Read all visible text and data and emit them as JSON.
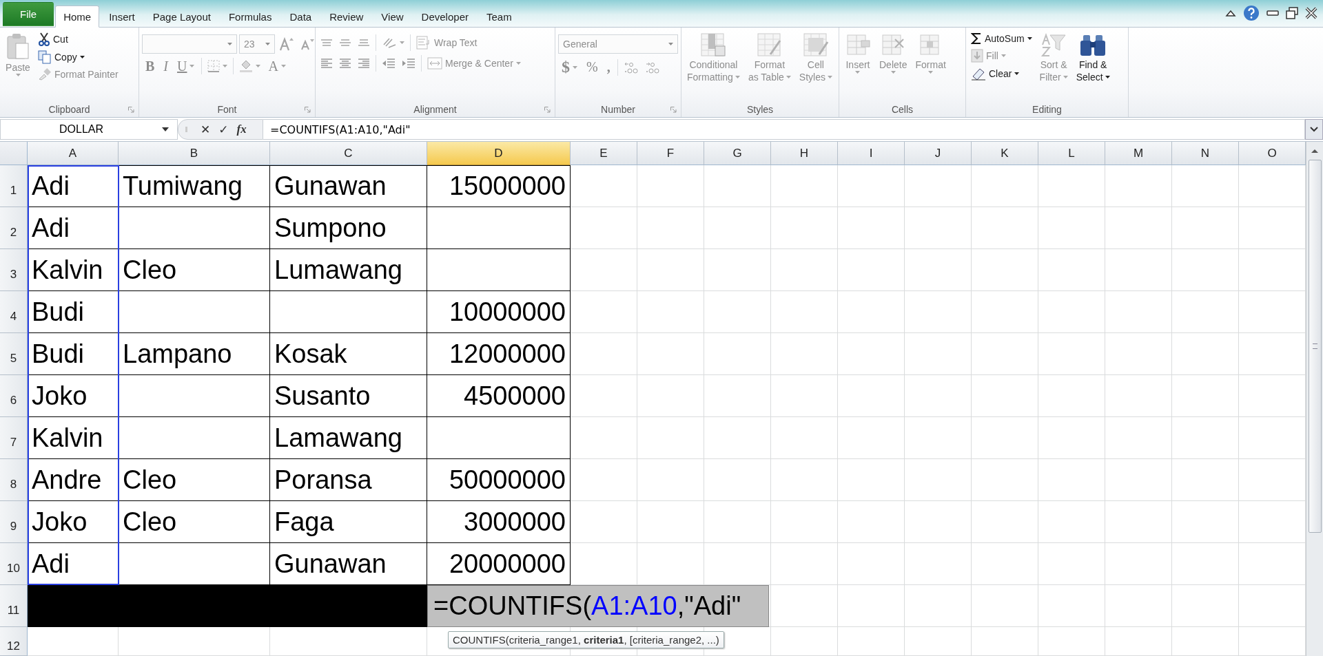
{
  "ribbon_tabs": [
    {
      "label": "File",
      "kind": "file",
      "selected": false
    },
    {
      "label": "Home",
      "kind": "tab",
      "selected": true
    },
    {
      "label": "Insert",
      "kind": "tab",
      "selected": false
    },
    {
      "label": "Page Layout",
      "kind": "tab",
      "selected": false
    },
    {
      "label": "Formulas",
      "kind": "tab",
      "selected": false
    },
    {
      "label": "Data",
      "kind": "tab",
      "selected": false
    },
    {
      "label": "Review",
      "kind": "tab",
      "selected": false
    },
    {
      "label": "View",
      "kind": "tab",
      "selected": false
    },
    {
      "label": "Developer",
      "kind": "tab",
      "selected": false
    },
    {
      "label": "Team",
      "kind": "tab",
      "selected": false
    }
  ],
  "ribbon_groups": [
    {
      "label": "Clipboard",
      "launcher": true,
      "items": [
        {
          "lines": [
            "Paste"
          ],
          "disabled": true,
          "dropdown": true
        },
        {
          "lines": [
            "Cut"
          ],
          "disabled": false,
          "dropdown": false
        },
        {
          "lines": [
            "Copy"
          ],
          "disabled": false,
          "dropdown": true
        },
        {
          "lines": [
            "Format Painter"
          ],
          "disabled": true,
          "dropdown": false
        }
      ]
    },
    {
      "label": "Font",
      "launcher": true,
      "items": [
        {
          "disabled": true,
          "dropdown": true
        },
        {
          "lines": [
            "23"
          ],
          "disabled": true,
          "dropdown": true
        },
        {
          "disabled": true,
          "dropdown": false
        },
        {
          "disabled": true,
          "dropdown": false
        },
        {
          "lines": [
            "B"
          ],
          "disabled": true,
          "dropdown": false
        },
        {
          "lines": [
            "I"
          ],
          "disabled": true,
          "dropdown": false
        },
        {
          "lines": [
            "U"
          ],
          "disabled": true,
          "dropdown": true
        },
        {
          "disabled": true,
          "dropdown": true
        },
        {
          "disabled": true,
          "dropdown": true
        },
        {
          "lines": [
            "A"
          ],
          "disabled": true,
          "dropdown": true
        }
      ]
    },
    {
      "label": "Alignment",
      "launcher": true,
      "items": [
        {
          "disabled": true,
          "dropdown": false
        },
        {
          "disabled": true,
          "dropdown": false
        },
        {
          "disabled": true,
          "dropdown": false
        },
        {
          "disabled": true,
          "dropdown": true
        },
        {
          "lines": [
            "Wrap Text"
          ],
          "disabled": true,
          "dropdown": false
        },
        {
          "disabled": true,
          "dropdown": false
        },
        {
          "disabled": true,
          "dropdown": false
        },
        {
          "disabled": true,
          "dropdown": false
        },
        {
          "disabled": true,
          "dropdown": false
        },
        {
          "disabled": true,
          "dropdown": false
        },
        {
          "lines": [
            "Merge & Center"
          ],
          "disabled": true,
          "dropdown": true
        }
      ]
    },
    {
      "label": "Number",
      "launcher": true,
      "items": [
        {
          "lines": [
            "General"
          ],
          "disabled": true,
          "dropdown": true
        },
        {
          "lines": [
            "$"
          ],
          "disabled": true,
          "dropdown": true
        },
        {
          "lines": [
            "%"
          ],
          "disabled": true,
          "dropdown": false
        },
        {
          "lines": [
            ","
          ],
          "disabled": true,
          "dropdown": false
        },
        {
          "disabled": true,
          "dropdown": false
        },
        {
          "disabled": true,
          "dropdown": false
        }
      ]
    },
    {
      "label": "Styles",
      "launcher": false,
      "items": [
        {
          "lines": [
            "Conditional",
            "Formatting"
          ],
          "disabled": true,
          "dropdown": true
        },
        {
          "lines": [
            "Format",
            "as Table"
          ],
          "disabled": true,
          "dropdown": true
        },
        {
          "lines": [
            "Cell",
            "Styles"
          ],
          "disabled": true,
          "dropdown": true
        }
      ]
    },
    {
      "label": "Cells",
      "launcher": false,
      "items": [
        {
          "lines": [
            "Insert"
          ],
          "disabled": true,
          "dropdown": true
        },
        {
          "lines": [
            "Delete"
          ],
          "disabled": true,
          "dropdown": true
        },
        {
          "lines": [
            "Format"
          ],
          "disabled": true,
          "dropdown": true
        }
      ]
    },
    {
      "label": "Editing",
      "launcher": false,
      "items": [
        {
          "lines": [
            "AutoSum"
          ],
          "disabled": false,
          "dropdown": true
        },
        {
          "lines": [
            "Fill"
          ],
          "disabled": true,
          "dropdown": true
        },
        {
          "lines": [
            "Clear"
          ],
          "disabled": false,
          "dropdown": true
        },
        {
          "lines": [
            "Sort &",
            "Filter"
          ],
          "disabled": true,
          "dropdown": true
        },
        {
          "lines": [
            "Find &",
            "Select"
          ],
          "disabled": false,
          "dropdown": true
        }
      ]
    }
  ],
  "formula_bar": {
    "name_box": "DOLLAR",
    "buttons": [
      "✕",
      "✓",
      "fx"
    ],
    "formula": "=COUNTIFS(A1:A10,\"Adi\""
  },
  "sheet": {
    "columns": [
      {
        "label": "A",
        "kind": "text",
        "selected": false,
        "referenced": true
      },
      {
        "label": "B",
        "kind": "text",
        "selected": false,
        "referenced": false
      },
      {
        "label": "C",
        "kind": "text",
        "selected": false,
        "referenced": false
      },
      {
        "label": "D",
        "kind": "number",
        "selected": true,
        "referenced": false
      },
      {
        "label": "E",
        "kind": "text",
        "selected": false,
        "referenced": false
      },
      {
        "label": "F",
        "kind": "text",
        "selected": false,
        "referenced": false
      },
      {
        "label": "G",
        "kind": "text",
        "selected": false,
        "referenced": false
      },
      {
        "label": "H",
        "kind": "text",
        "selected": false,
        "referenced": false
      },
      {
        "label": "I",
        "kind": "text",
        "selected": false,
        "referenced": false
      },
      {
        "label": "J",
        "kind": "text",
        "selected": false,
        "referenced": false
      },
      {
        "label": "K",
        "kind": "text",
        "selected": false,
        "referenced": false
      },
      {
        "label": "L",
        "kind": "text",
        "selected": false,
        "referenced": false
      },
      {
        "label": "M",
        "kind": "text",
        "selected": false,
        "referenced": false
      },
      {
        "label": "N",
        "kind": "text",
        "selected": false,
        "referenced": false
      },
      {
        "label": "O",
        "kind": "text",
        "selected": false,
        "referenced": false
      }
    ],
    "rows": [
      {
        "header": "1",
        "cells": [
          "Adi",
          "Tumiwang",
          "Gunawan",
          "15000000"
        ],
        "filled_black": false
      },
      {
        "header": "2",
        "cells": [
          "Adi",
          null,
          "Sumpono",
          null
        ],
        "filled_black": false
      },
      {
        "header": "3",
        "cells": [
          "Kalvin",
          "Cleo",
          "Lumawang",
          null
        ],
        "filled_black": false
      },
      {
        "header": "4",
        "cells": [
          "Budi",
          null,
          null,
          "10000000"
        ],
        "filled_black": false
      },
      {
        "header": "5",
        "cells": [
          "Budi",
          "Lampano",
          "Kosak",
          "12000000"
        ],
        "filled_black": false
      },
      {
        "header": "6",
        "cells": [
          "Joko",
          null,
          "Susanto",
          "4500000"
        ],
        "filled_black": false
      },
      {
        "header": "7",
        "cells": [
          "Kalvin",
          null,
          "Lamawang",
          null
        ],
        "filled_black": false
      },
      {
        "header": "8",
        "cells": [
          "Andre",
          "Cleo",
          "Poransa",
          "50000000"
        ],
        "filled_black": false
      },
      {
        "header": "9",
        "cells": [
          "Joko",
          "Cleo",
          "Faga",
          "3000000"
        ],
        "filled_black": false
      },
      {
        "header": "10",
        "cells": [
          "Adi",
          null,
          "Gunawan",
          "20000000"
        ],
        "filled_black": false
      },
      {
        "header": "11",
        "filled_black": true
      },
      {
        "header": "12",
        "filled_black": false
      }
    ],
    "cell_editor": {
      "segments": [
        {
          "text": "=COUNTIFS(",
          "color": "#000000"
        },
        {
          "text": "A1:A10",
          "color": "#0000ff"
        },
        {
          "text": ",\"Adi\"",
          "color": "#000000"
        }
      ]
    },
    "tooltip": "COUNTIFS(criteria_range1, **criteria1**, [criteria_range2, ...)"
  }
}
